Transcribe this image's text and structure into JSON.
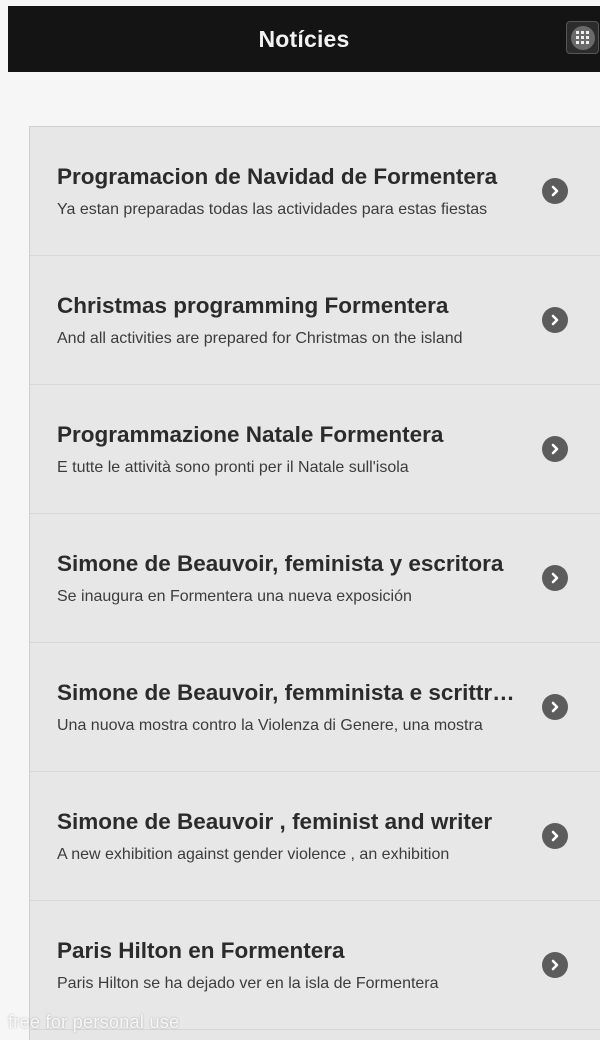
{
  "header": {
    "title": "Notícies",
    "menu_icon": "grid-menu-icon"
  },
  "news": [
    {
      "title": "Programacion de Navidad de Formentera",
      "description": "Ya estan preparadas todas las actividades para estas fiestas"
    },
    {
      "title": "Christmas programming Formentera",
      "description": "And all activities are prepared for Christmas on the island"
    },
    {
      "title": "Programmazione Natale Formentera",
      "description": "E tutte le attività sono pronti per il Natale sull'isola"
    },
    {
      "title": "Simone de Beauvoir, feminista y escritora",
      "description": "Se inaugura en Formentera una nueva exposición"
    },
    {
      "title": "Simone de Beauvoir, femminista e scrittrice",
      "description": "Una nuova mostra contro la Violenza di Genere, una mostra"
    },
    {
      "title": "Simone de Beauvoir , feminist and writer",
      "description": "A new exhibition against gender violence , an exhibition"
    },
    {
      "title": "Paris Hilton en Formentera",
      "description": "Paris Hilton se ha dejado ver en la isla de Formentera"
    }
  ],
  "row_icon": "chevron-right-icon",
  "watermark": "free for personal use"
}
